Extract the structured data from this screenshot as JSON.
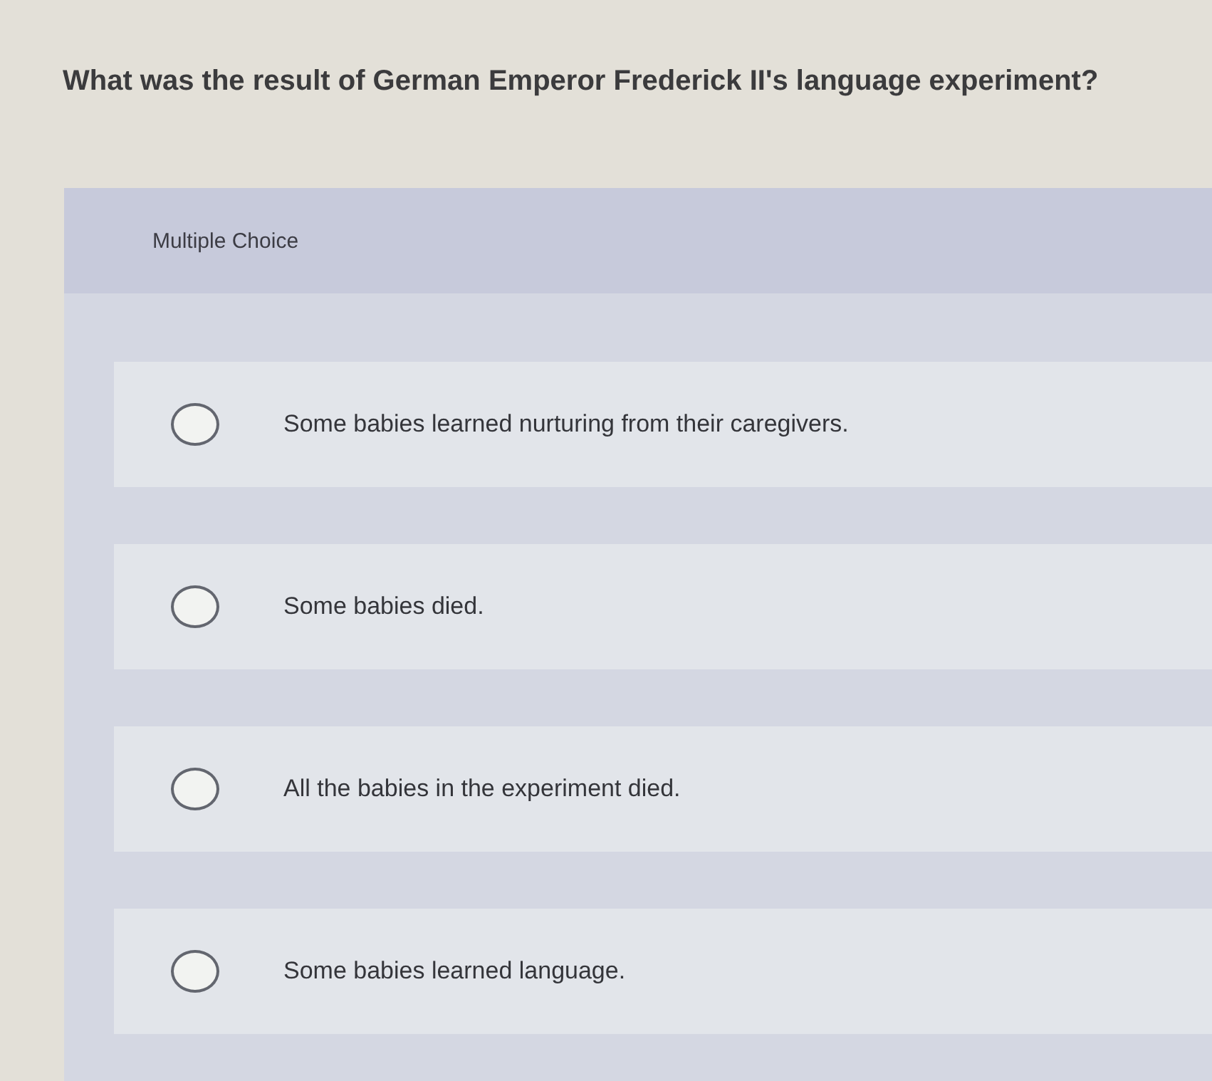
{
  "question": "What was the result of German Emperor Frederick II's language experiment?",
  "section": {
    "label": "Multiple Choice"
  },
  "options": [
    {
      "text": "Some babies learned nurturing from their caregivers.",
      "selected": false
    },
    {
      "text": "Some babies died.",
      "selected": false
    },
    {
      "text": "All the babies in the experiment died.",
      "selected": false
    },
    {
      "text": "Some babies learned language.",
      "selected": false
    }
  ]
}
